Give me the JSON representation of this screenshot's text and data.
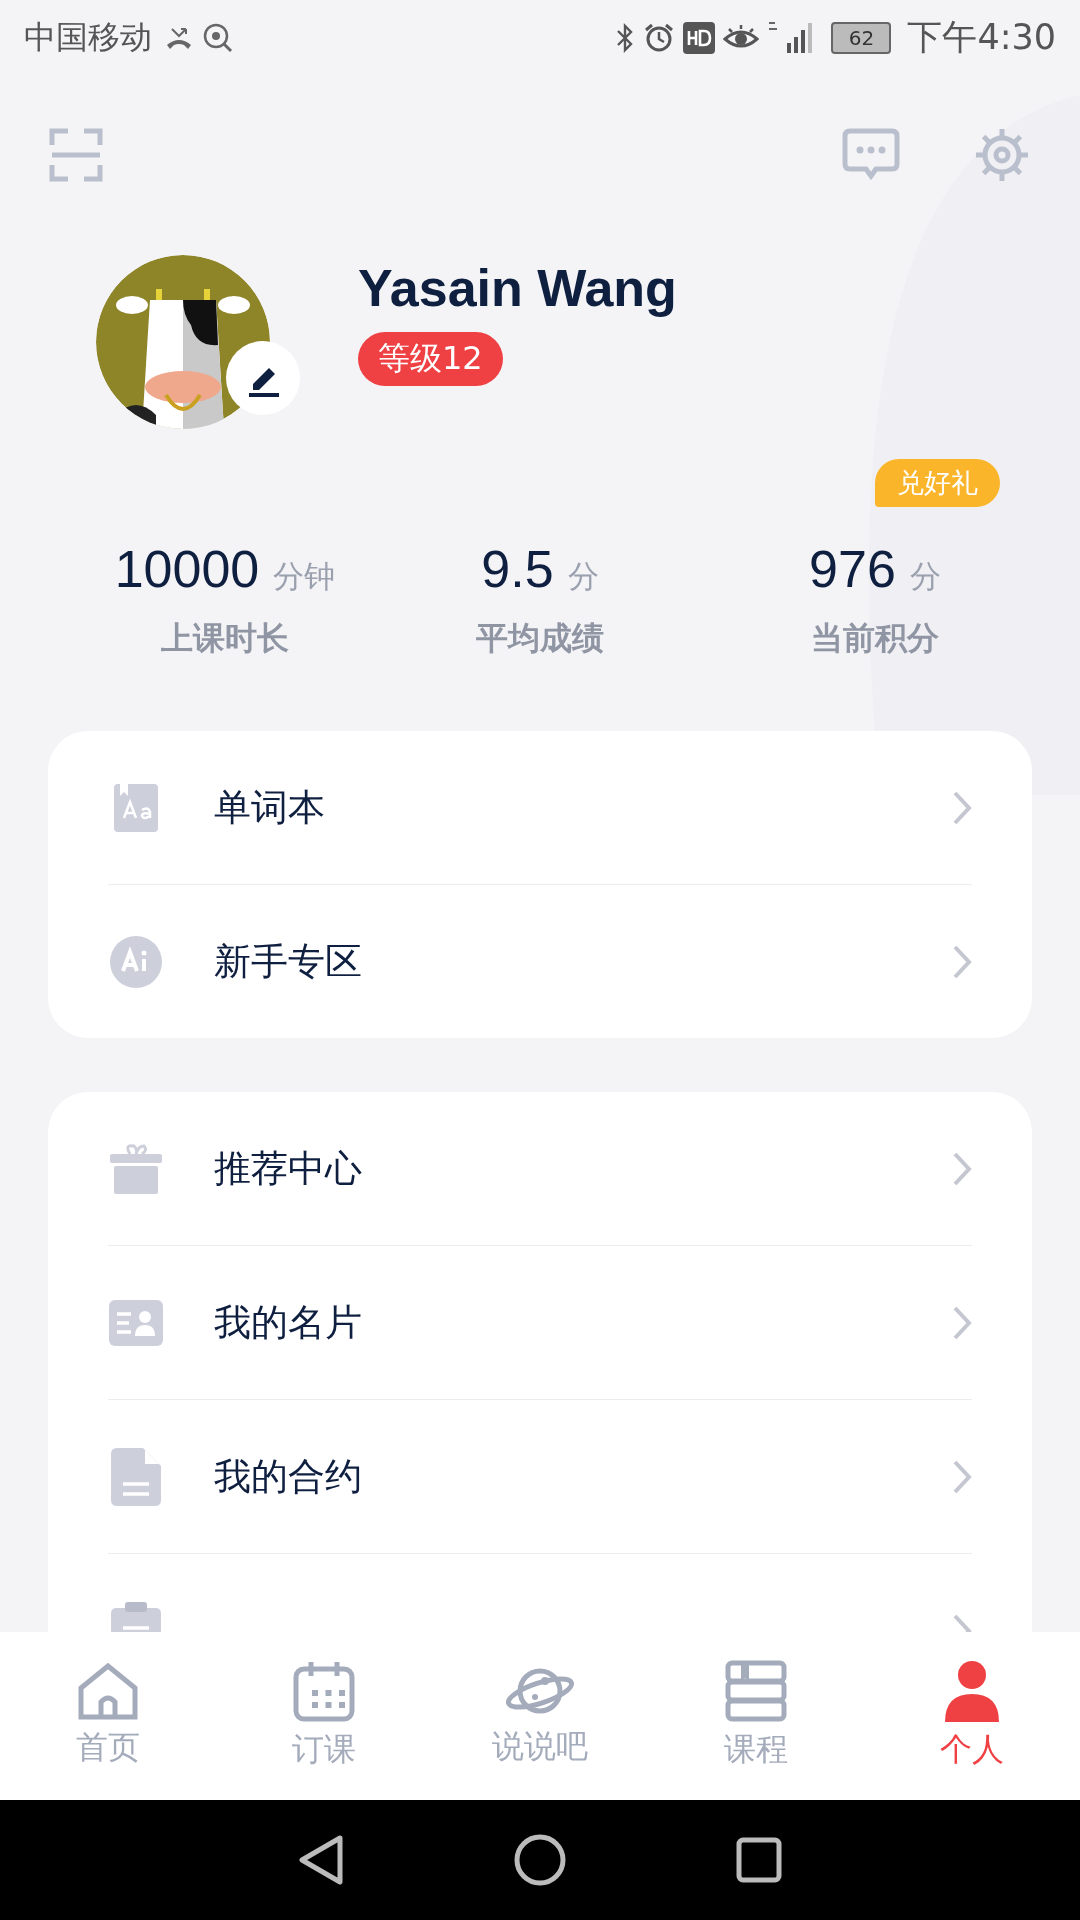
{
  "status_bar": {
    "carrier": "中国移动",
    "battery": "62",
    "time": "下午4:30"
  },
  "profile": {
    "name": "Yasain Wang",
    "level_badge": "等级12"
  },
  "stats": [
    {
      "value": "10000",
      "unit": "分钟",
      "label": "上课时长"
    },
    {
      "value": "9.5",
      "unit": "分",
      "label": "平均成绩"
    },
    {
      "value": "976",
      "unit": "分",
      "label": "当前积分",
      "badge": "兑好礼"
    }
  ],
  "menu_groups": [
    [
      {
        "kind": "book",
        "label": "单词本"
      },
      {
        "kind": "ai",
        "label": "新手专区"
      }
    ],
    [
      {
        "kind": "gift",
        "label": "推荐中心"
      },
      {
        "kind": "card",
        "label": "我的名片"
      },
      {
        "kind": "doc",
        "label": "我的合约"
      },
      {
        "kind": "clipboard"
      }
    ]
  ],
  "tabs": [
    {
      "kind": "home",
      "label": "首页",
      "selected": false
    },
    {
      "kind": "calendar",
      "label": "订课",
      "selected": false
    },
    {
      "kind": "planet",
      "label": "说说吧",
      "selected": false
    },
    {
      "kind": "books",
      "label": "课程",
      "selected": false
    },
    {
      "kind": "person",
      "label": "个人",
      "selected": true
    }
  ]
}
